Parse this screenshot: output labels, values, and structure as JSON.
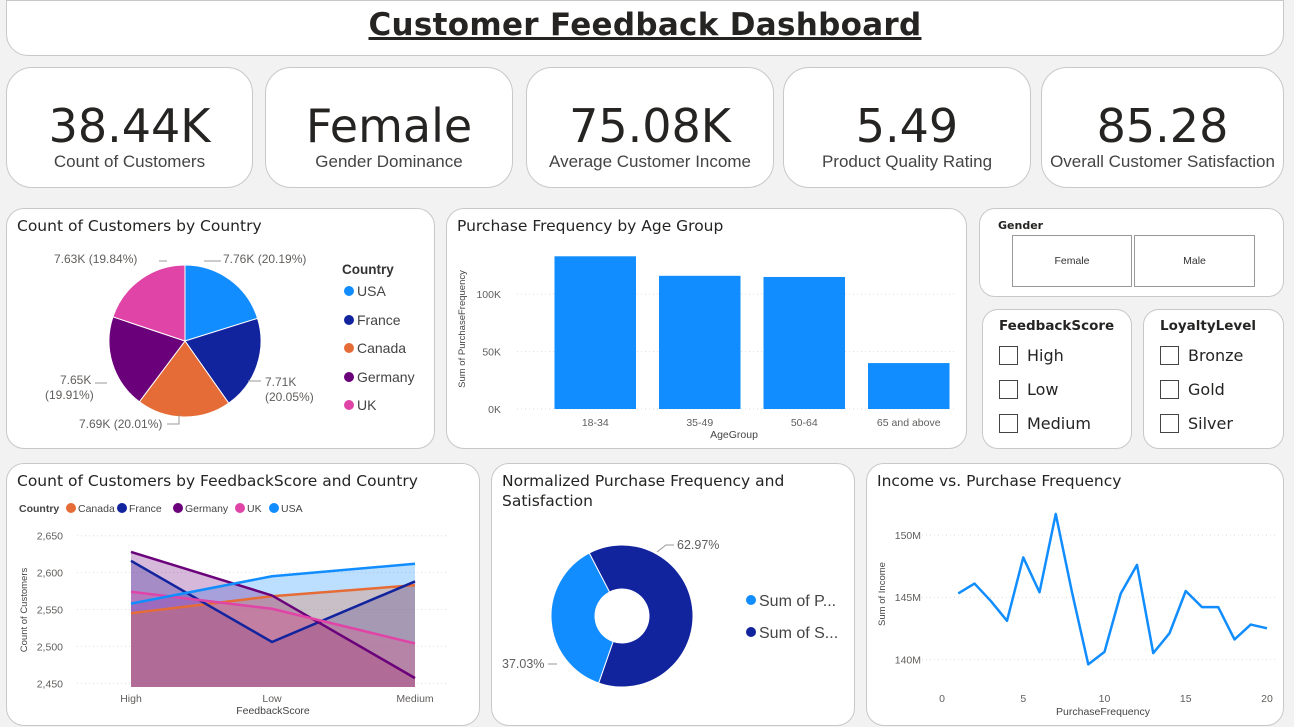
{
  "header": {
    "title": "Customer Feedback Dashboard"
  },
  "kpis": [
    {
      "value": "38.44K",
      "label": "Count of Customers"
    },
    {
      "value": "Female",
      "label": "Gender Dominance"
    },
    {
      "value": "75.08K",
      "label": "Average Customer Income"
    },
    {
      "value": "5.49",
      "label": "Product Quality Rating"
    },
    {
      "value": "85.28",
      "label": "Overall Customer Satisfaction"
    }
  ],
  "slicers": {
    "gender": {
      "title": "Gender",
      "options": [
        "Female",
        "Male"
      ]
    },
    "feedback": {
      "title": "FeedbackScore",
      "options": [
        "High",
        "Low",
        "Medium"
      ]
    },
    "loyalty": {
      "title": "LoyaltyLevel",
      "options": [
        "Bronze",
        "Gold",
        "Silver"
      ]
    }
  },
  "colors": {
    "usa": "#118DFF",
    "france": "#12239E",
    "canada": "#E66C37",
    "germany": "#6B007B",
    "uk": "#E044A7"
  },
  "chart_data": [
    {
      "type": "pie",
      "title": "Count of Customers by Country",
      "legend_title": "Country",
      "legend_position": "right",
      "slices": [
        {
          "name": "USA",
          "value": 7.76,
          "label": "7.76K (20.19%)",
          "color": "#118DFF"
        },
        {
          "name": "France",
          "value": 7.71,
          "label": "7.71K (20.05%)",
          "label_line1": "7.71K",
          "label_line2": "(20.05%)",
          "color": "#12239E"
        },
        {
          "name": "Canada",
          "value": 7.69,
          "label": "7.69K (20.01%)",
          "color": "#E66C37"
        },
        {
          "name": "Germany",
          "value": 7.65,
          "label": "7.65K (19.91%)",
          "label_line1": "7.65K",
          "label_line2": "(19.91%)",
          "color": "#6B007B"
        },
        {
          "name": "UK",
          "value": 7.63,
          "label": "7.63K (19.84%)",
          "color": "#E044A7"
        }
      ]
    },
    {
      "type": "bar",
      "title": "Purchase Frequency by Age Group",
      "xlabel": "AgeGroup",
      "ylabel": "Sum of PurchaseFrequency",
      "categories": [
        "18-34",
        "35-49",
        "50-64",
        "65 and above"
      ],
      "values": [
        133000,
        116000,
        115000,
        40000
      ],
      "ylim": [
        0,
        135000
      ],
      "yticks": [
        0,
        50000,
        100000
      ],
      "ytick_labels": [
        "0K",
        "50K",
        "100K"
      ],
      "grid": true,
      "color": "#118DFF"
    },
    {
      "type": "area",
      "title": "Count of Customers by FeedbackScore and Country",
      "legend_title": "Country",
      "legend_position": "top-left",
      "xlabel": "FeedbackScore",
      "ylabel": "Count of Customers",
      "categories": [
        "High",
        "Low",
        "Medium"
      ],
      "ylim": [
        2445,
        2655
      ],
      "yticks": [
        2450,
        2500,
        2550,
        2600,
        2650
      ],
      "ytick_labels": [
        "2,450",
        "2,500",
        "2,550",
        "2,600",
        "2,650"
      ],
      "series": [
        {
          "name": "Canada",
          "values": [
            2545,
            2568,
            2583
          ],
          "color": "#E66C37"
        },
        {
          "name": "France",
          "values": [
            2616,
            2506,
            2588
          ],
          "color": "#12239E"
        },
        {
          "name": "Germany",
          "values": [
            2628,
            2569,
            2457
          ],
          "color": "#6B007B"
        },
        {
          "name": "UK",
          "values": [
            2574,
            2551,
            2504
          ],
          "color": "#E044A7"
        },
        {
          "name": "USA",
          "values": [
            2558,
            2595,
            2612
          ],
          "color": "#118DFF"
        }
      ]
    },
    {
      "type": "pie",
      "donut": true,
      "title": "Normalized Purchase Frequency and Satisfaction",
      "title_line1": "Normalized Purchase Frequency and",
      "title_line2": "Satisfaction",
      "legend_position": "right",
      "slices": [
        {
          "name": "Sum of P...",
          "value": 37.03,
          "label": "37.03%",
          "color": "#118DFF"
        },
        {
          "name": "Sum of S...",
          "value": 62.97,
          "label": "62.97%",
          "color": "#12239E"
        }
      ]
    },
    {
      "type": "line",
      "title": "Income vs. Purchase Frequency",
      "xlabel": "PurchaseFrequency",
      "ylabel": "Sum of Income",
      "x": [
        1,
        2,
        3,
        4,
        5,
        6,
        7,
        8,
        9,
        10,
        11,
        12,
        13,
        14,
        15,
        16,
        17,
        18,
        19,
        20
      ],
      "y": [
        145.3,
        146.1,
        144.7,
        143.1,
        148.2,
        145.4,
        151.7,
        145.4,
        139.6,
        140.6,
        145.3,
        147.6,
        140.5,
        142.1,
        145.5,
        144.2,
        144.2,
        141.6,
        142.8,
        142.5
      ],
      "xlim": [
        0,
        20
      ],
      "xticks": [
        0,
        5,
        10,
        15,
        20
      ],
      "ylim": [
        138.5,
        152.5
      ],
      "yticks": [
        140,
        145,
        150
      ],
      "ytick_labels": [
        "140M",
        "145M",
        "150M"
      ],
      "grid": true,
      "color": "#118DFF"
    }
  ]
}
